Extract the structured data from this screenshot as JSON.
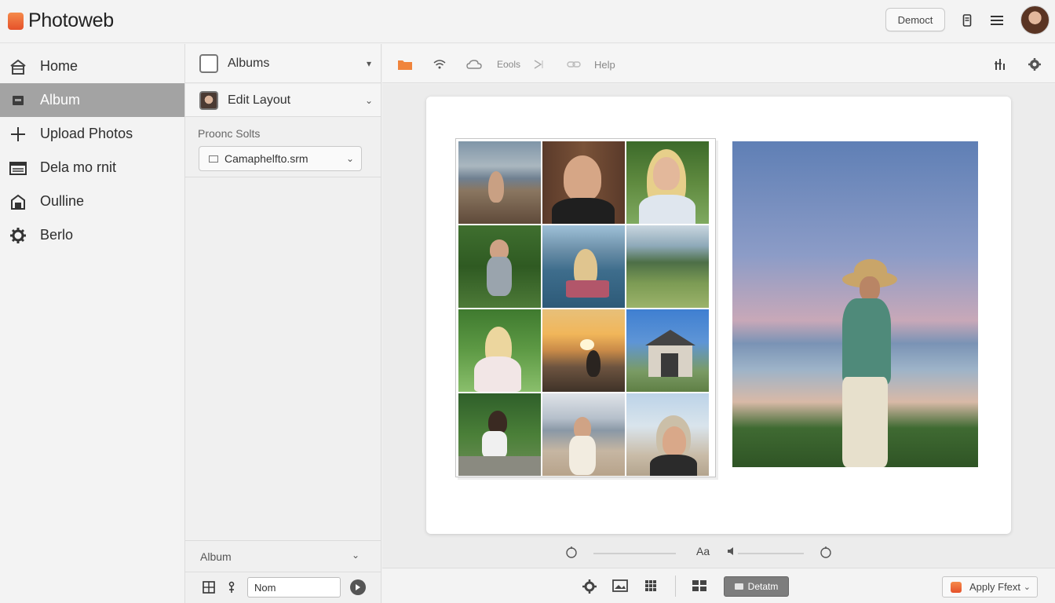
{
  "app": {
    "title": "Photoweb",
    "demo_button": "Democt"
  },
  "nav": {
    "items": [
      {
        "label": "Home",
        "icon": "home-icon"
      },
      {
        "label": "Album",
        "icon": "album-icon",
        "active": true
      },
      {
        "label": "Upload Photos",
        "icon": "plus-icon"
      },
      {
        "label": "Dela mo rnit",
        "icon": "calendar-icon"
      },
      {
        "label": "Oulline",
        "icon": "bag-icon"
      },
      {
        "label": "Berlo",
        "icon": "gear-icon"
      }
    ]
  },
  "panel": {
    "albums_label": "Albums",
    "edit_layout_label": "Edit Layout",
    "section_label": "Proonc Solts",
    "select_value": "Camaphelfto.srm",
    "footer_label": "Album",
    "name_input_value": "Nom"
  },
  "toolbar": {
    "items": [
      "folder-icon",
      "wifi-icon",
      "cloud-icon",
      "Eools",
      "play-icon",
      "link-icon"
    ],
    "tools_label": "Eools",
    "help_label": "Help"
  },
  "zoom": {
    "text_label": "Aa"
  },
  "bottom": {
    "default_button": "Detatm",
    "apply_button": "Apply Ffext"
  },
  "colors": {
    "accent": "#e8622f",
    "active_nav": "#a3a3a3"
  }
}
